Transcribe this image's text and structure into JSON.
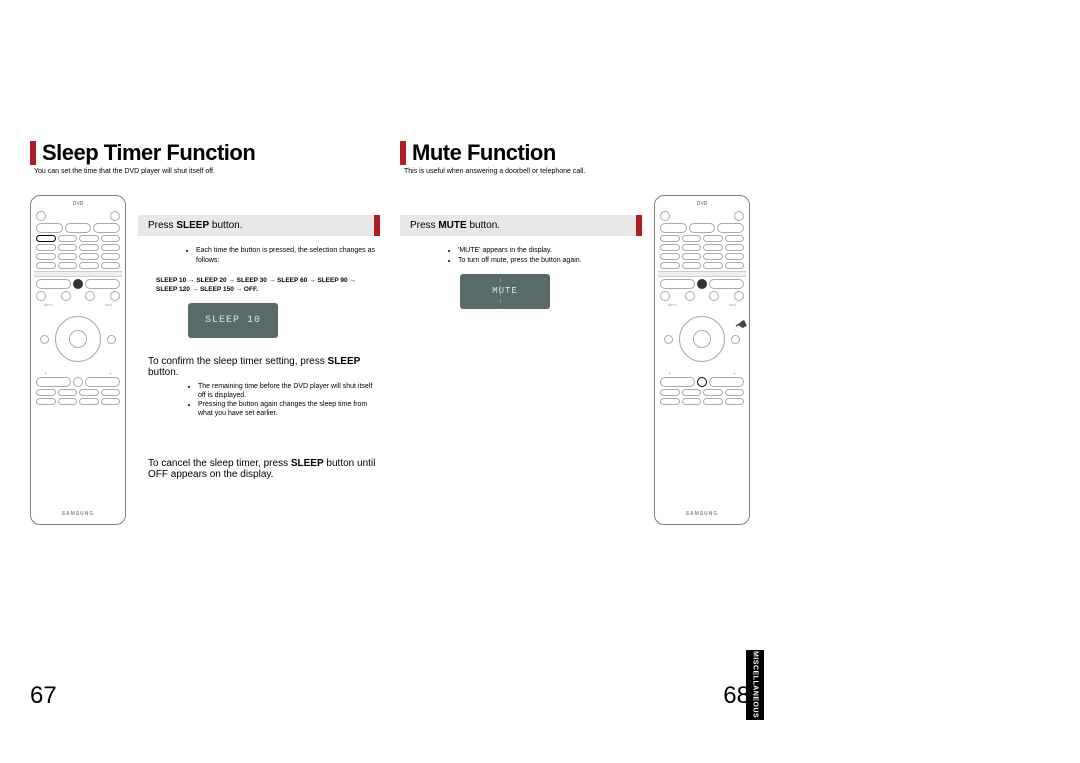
{
  "leftPage": {
    "title": "Sleep Timer Function",
    "subtitle": "You can set the time that the DVD player will shut itself off.",
    "instruction": {
      "prefix": "Press ",
      "bold": "SLEEP",
      "suffix": " button."
    },
    "bullet1": "Each time the button is pressed, the selection changes as follows:",
    "sequence_line1": "SLEEP 10 → SLEEP 20 → SLEEP 30 → SLEEP 60 → SLEEP 90 →",
    "sequence_line2": "SLEEP 120 → SLEEP 150 → OFF.",
    "displayText": "SLEEP 10",
    "confirm": {
      "prefix": "To confirm the sleep timer setting, press ",
      "bold": "SLEEP",
      "suffix": " button."
    },
    "confirm_sub1": "The remaining time before the DVD player will shut itself off is displayed.",
    "confirm_sub2": "Pressing the button again changes the sleep time from what you have set earlier.",
    "cancel_line1_prefix": "To cancel the sleep timer, press ",
    "cancel_line1_bold": "SLEEP",
    "cancel_line1_suffix": " button until",
    "cancel_line2": "OFF appears on the display.",
    "pageNumber": "67"
  },
  "rightPage": {
    "title": "Mute Function",
    "subtitle": "This is useful when answering a doorbell or telephone call.",
    "instruction": {
      "prefix": "Press ",
      "bold": "MUTE",
      "suffix": " button."
    },
    "bullet1": "'MUTE' appears in the display.",
    "bullet2": "To turn off mute, press the button again.",
    "displayText": "MUTE",
    "pageNumber": "68",
    "sideTab": "MISCELLANEOUS"
  },
  "remote": {
    "brand": "SAMSUNG",
    "logo": "DVD"
  }
}
